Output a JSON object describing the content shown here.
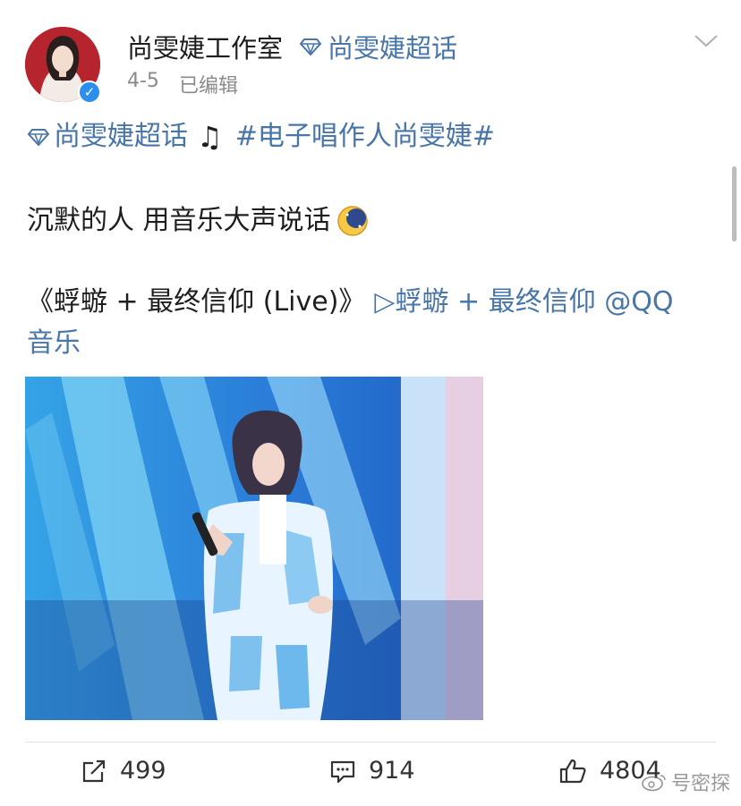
{
  "post": {
    "username": "尚雯婕工作室",
    "header_topic": "尚雯婕超话",
    "date": "4-5",
    "edited": "已编辑",
    "topic": "尚雯婕超话",
    "hashtag": "#电子唱作人尚雯婕#",
    "text": "沉默的人 用音乐大声说话",
    "song_title": "《蜉蝣 + 最终信仰 (Live)》",
    "song_link": "▷蜉蝣 + 最终信仰 @QQ",
    "song_link_cont": "音乐"
  },
  "actions": {
    "repost_count": "499",
    "comment_count": "914",
    "like_count": "4804"
  },
  "icons": {
    "verify": "✓",
    "note": "♫"
  },
  "colors": {
    "link": "#4876a8",
    "verified": "#2c8ff0"
  },
  "watermark": {
    "text": "号密探"
  }
}
